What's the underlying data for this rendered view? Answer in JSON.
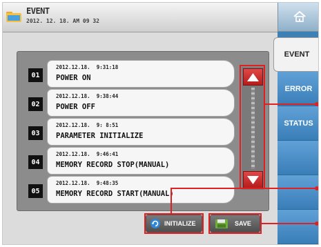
{
  "header": {
    "title": "EVENT",
    "datetime": "2012. 12. 18.  AM 09 32"
  },
  "sidebar": {
    "tabs": [
      {
        "label": "EVENT",
        "active": true
      },
      {
        "label": "ERROR",
        "active": false
      },
      {
        "label": "STATUS",
        "active": false
      },
      {
        "label": "",
        "active": false
      },
      {
        "label": "",
        "active": false
      },
      {
        "label": "",
        "active": false
      }
    ]
  },
  "events": [
    {
      "num": "01",
      "timestamp": "2012.12.18.  9:31:18",
      "message": "POWER ON"
    },
    {
      "num": "02",
      "timestamp": "2012.12.18.  9:38:44",
      "message": "POWER OFF"
    },
    {
      "num": "03",
      "timestamp": "2012.12.18.  9: 8:51",
      "message": "PARAMETER INITIALIZE"
    },
    {
      "num": "04",
      "timestamp": "2012.12.18.  9:46:41",
      "message": "MEMORY RECORD STOP(MANUAL)"
    },
    {
      "num": "05",
      "timestamp": "2012.12.18.  9:48:35",
      "message": "MEMORY RECORD START(MANUAL)"
    }
  ],
  "buttons": {
    "initialize": "INITIALIZE",
    "save": "SAVE"
  },
  "icons": {
    "header": "folder-icon",
    "home": "home-icon",
    "initialize": "refresh-icon",
    "save": "save-disk-icon",
    "scroll_up": "arrow-up-icon",
    "scroll_down": "arrow-down-icon"
  },
  "colors": {
    "accent_tab": "#3d80b5",
    "highlight": "#e02020",
    "panel": "#8c8c8c"
  }
}
